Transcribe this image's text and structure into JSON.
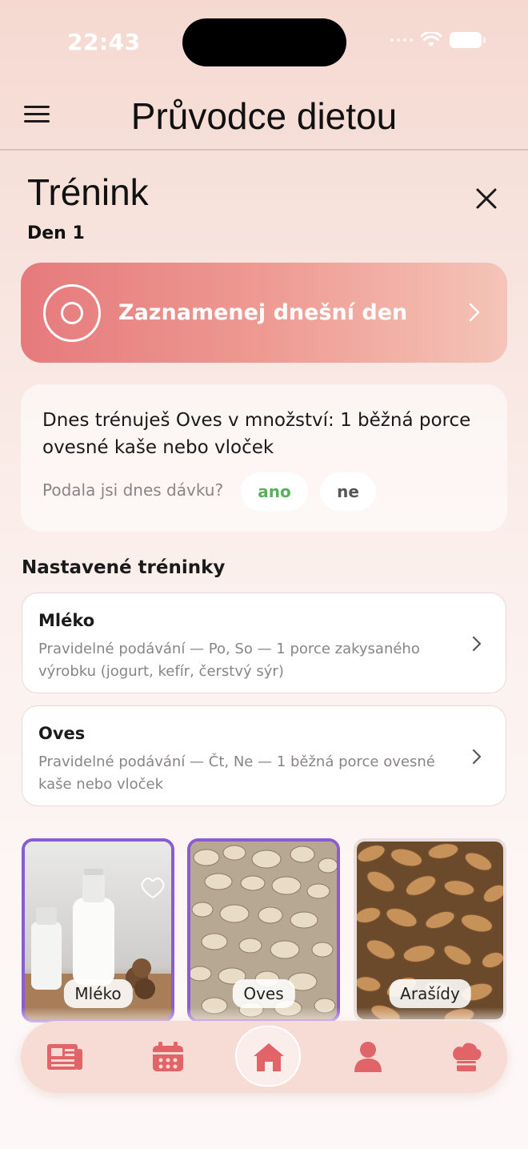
{
  "status_bar": {
    "time": "22:43"
  },
  "header": {
    "title": "Průvodce dietou",
    "menu_icon": "hamburger-menu-icon"
  },
  "training": {
    "title": "Trénink",
    "day": "Den 1",
    "close_icon": "close-icon"
  },
  "record": {
    "label": "Zaznamenej dnešní den",
    "icon": "circle-record-icon",
    "chevron": "chevron-right-icon"
  },
  "today": {
    "text": "Dnes trénuješ Oves v množství: 1 běžná porce ovesné kaše nebo vloček",
    "question": "Podala jsi dnes dávku?",
    "yes_label": "ano",
    "no_label": "ne"
  },
  "settings": {
    "title": "Nastavené tréninky",
    "items": [
      {
        "title": "Mléko",
        "description": "Pravidelné podávání — Po, So — 1 porce zakysaného výrobku (jogurt, kefír, čerstvý sýr)"
      },
      {
        "title": "Oves",
        "description": "Pravidelné podávání — Čt, Ne — 1 běžná porce ovesné kaše nebo vloček"
      }
    ]
  },
  "foods": [
    {
      "label": "Mléko",
      "selected": true
    },
    {
      "label": "Oves",
      "selected": true
    },
    {
      "label": "Arašídy",
      "selected": false
    }
  ],
  "nav": {
    "items": [
      "news-icon",
      "calendar-icon",
      "home-icon",
      "profile-icon",
      "chef-hat-icon"
    ],
    "active": "home-icon"
  },
  "colors": {
    "accent": "#e67a7c",
    "selected_border": "#8a5cd0",
    "yes_green": "#58b05a",
    "nav_icon": "#e06468"
  }
}
